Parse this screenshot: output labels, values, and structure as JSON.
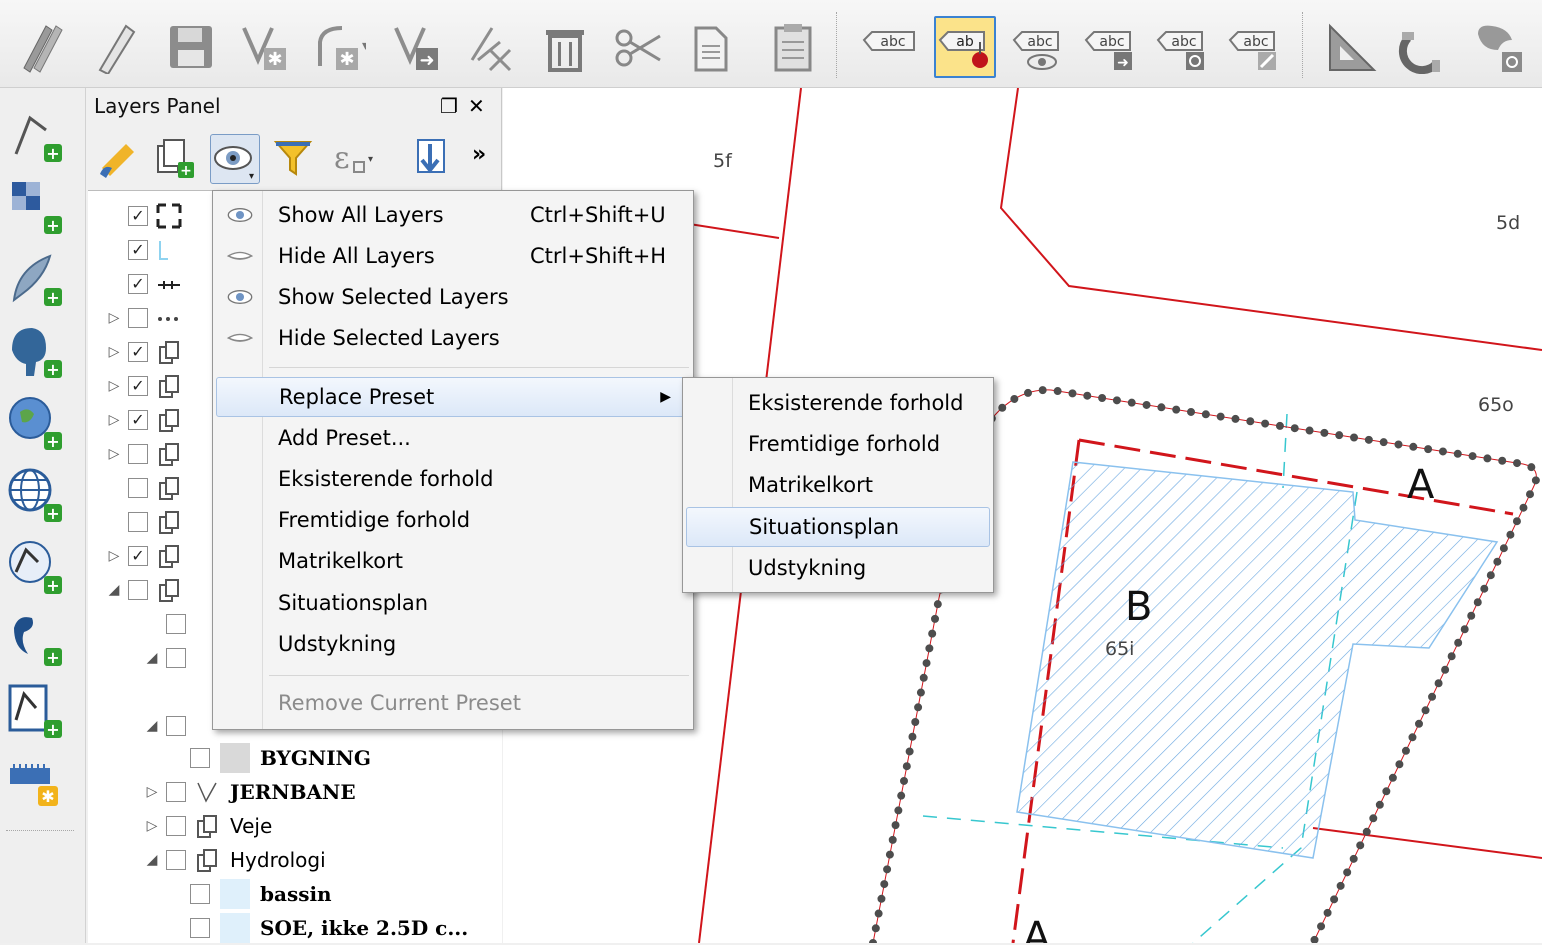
{
  "panel": {
    "title": "Layers Panel"
  },
  "visibility_menu": {
    "items": [
      {
        "label": "Show All Layers",
        "shortcut": "Ctrl+Shift+U",
        "icon": "eye-open-icon"
      },
      {
        "label": "Hide All Layers",
        "shortcut": "Ctrl+Shift+H",
        "icon": "eye-closed-icon"
      },
      {
        "label": "Show Selected Layers",
        "icon": "eye-open-icon"
      },
      {
        "label": "Hide Selected Layers",
        "icon": "eye-closed-icon"
      },
      {
        "label": "Replace Preset",
        "submenu": true
      },
      {
        "label": "Add Preset..."
      },
      {
        "label": "Eksisterende forhold"
      },
      {
        "label": "Fremtidige forhold"
      },
      {
        "label": "Matrikelkort"
      },
      {
        "label": "Situationsplan"
      },
      {
        "label": "Udstykning"
      },
      {
        "label": "Remove Current Preset",
        "disabled": true
      }
    ]
  },
  "replace_preset_submenu": {
    "items": [
      {
        "label": "Eksisterende forhold"
      },
      {
        "label": "Fremtidige forhold"
      },
      {
        "label": "Matrikelkort"
      },
      {
        "label": "Situationsplan",
        "highlighted": true
      },
      {
        "label": "Udstykning"
      }
    ]
  },
  "layers": {
    "visible": [
      {
        "label": "BYGNING",
        "checked": false,
        "swatch": "#d9d9d9"
      },
      {
        "label": "JERNBANE",
        "checked": false
      },
      {
        "label": "Veje",
        "checked": false
      },
      {
        "label": "Hydrologi",
        "checked": false
      },
      {
        "label": "bassin",
        "checked": false,
        "swatch": "#dff0fb"
      },
      {
        "label": "SOE, ikke 2.5D c...",
        "checked": false,
        "swatch": "#dff0fb"
      }
    ]
  },
  "map": {
    "parcel_labels": [
      "5f",
      "5d",
      "65o",
      "65i"
    ],
    "letters": [
      "A",
      "B",
      "A"
    ]
  },
  "colors": {
    "accent": "#3a82d2",
    "parcel_line": "#d1151b",
    "building_hatch": "#6aa7e0",
    "dotted_boundary": "#4d4d4d",
    "highlight": "#dce8f8"
  }
}
